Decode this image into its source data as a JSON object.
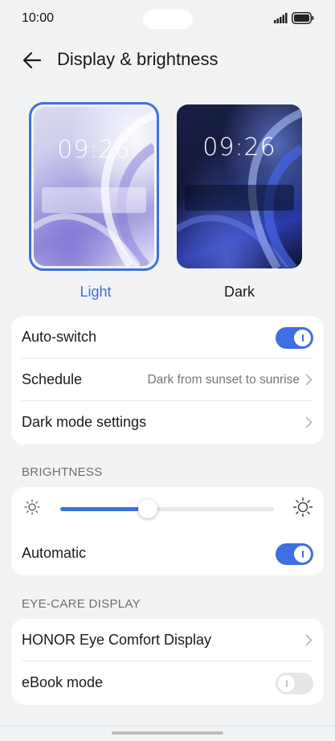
{
  "status_bar": {
    "time": "10:00"
  },
  "header": {
    "title": "Display & brightness"
  },
  "themes": [
    {
      "label": "Light",
      "clock": "09:26",
      "selected": true
    },
    {
      "label": "Dark",
      "clock": "09:26",
      "selected": false
    }
  ],
  "mode_settings": {
    "auto_switch": {
      "label": "Auto-switch",
      "enabled": true
    },
    "schedule": {
      "label": "Schedule",
      "value": "Dark from sunset to sunrise"
    },
    "dark_mode_settings": {
      "label": "Dark mode settings"
    }
  },
  "brightness": {
    "heading": "BRIGHTNESS",
    "level_fraction": 0.41,
    "automatic": {
      "label": "Automatic",
      "enabled": true
    }
  },
  "eye_care": {
    "heading": "EYE-CARE DISPLAY",
    "honor_eye_comfort": {
      "label": "HONOR Eye Comfort Display"
    },
    "ebook_mode": {
      "label": "eBook mode",
      "enabled": false
    }
  },
  "colors": {
    "accent": "#3f6fe0",
    "background": "#f1f3f5",
    "card": "#ffffff"
  }
}
